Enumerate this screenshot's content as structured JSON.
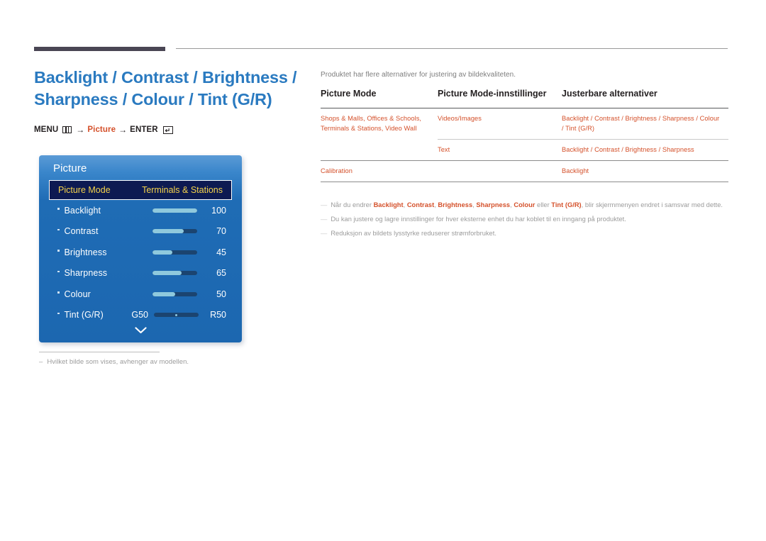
{
  "page": {
    "title": "Backlight / Contrast / Brightness / Sharpness / Colour / Tint (G/R)",
    "breadcrumb": {
      "menu_label": "MENU",
      "menu_icon": "menu-grid-icon",
      "arrow1": "→",
      "picture_label": "Picture",
      "arrow2": "→",
      "enter_label": "ENTER",
      "enter_icon": "enter-key-icon"
    }
  },
  "osd": {
    "title": "Picture",
    "selected_row": {
      "label": "Picture Mode",
      "value": "Terminals & Stations"
    },
    "rows": [
      {
        "label": "Backlight",
        "value": "100",
        "fill_percent": 100
      },
      {
        "label": "Contrast",
        "value": "70",
        "fill_percent": 70
      },
      {
        "label": "Brightness",
        "value": "45",
        "fill_percent": 45
      },
      {
        "label": "Sharpness",
        "value": "65",
        "fill_percent": 65
      },
      {
        "label": "Colour",
        "value": "50",
        "fill_percent": 50
      }
    ],
    "tint_row": {
      "label": "Tint (G/R)",
      "left_value": "G50",
      "right_value": "R50",
      "knob_percent": 50
    },
    "scroll_indicator": "chevron-down-icon",
    "colors": {
      "panel_top": "#5b9bd6",
      "panel_bottom": "#1c67b0",
      "highlight_bg": "#0d1a52",
      "highlight_text": "#f5d34b",
      "slider_fill": "#8fc9dd",
      "slider_track": "#1b4470"
    }
  },
  "left_footnote": {
    "dash": "–",
    "text": "Hvilket bilde som vises, avhenger av modellen."
  },
  "right": {
    "intro": "Produktet har flere alternativer for justering av bildekvaliteten.",
    "table": {
      "headers": [
        "Picture Mode",
        "Picture Mode-innstillinger",
        "Justerbare alternativer"
      ],
      "rows": [
        {
          "mode": "Shops & Malls, Offices & Schools, Terminals & Stations, Video Wall",
          "setting": "Videos/Images",
          "options": "Backlight / Contrast / Brightness / Sharpness / Colour / Tint (G/R)"
        },
        {
          "mode": "",
          "setting": "Text",
          "options": "Backlight / Contrast / Brightness / Sharpness"
        },
        {
          "mode": "Calibration",
          "setting": "",
          "options": "Backlight"
        }
      ]
    },
    "notes": [
      {
        "dash": "—",
        "parts": [
          {
            "t": "Når du endrer ",
            "b": false
          },
          {
            "t": "Backlight",
            "b": true
          },
          {
            "t": ", ",
            "b": false
          },
          {
            "t": "Contrast",
            "b": true
          },
          {
            "t": ", ",
            "b": false
          },
          {
            "t": "Brightness",
            "b": true
          },
          {
            "t": ", ",
            "b": false
          },
          {
            "t": "Sharpness",
            "b": true
          },
          {
            "t": ", ",
            "b": false
          },
          {
            "t": "Colour",
            "b": true
          },
          {
            "t": " eller ",
            "b": false
          },
          {
            "t": "Tint (G/R)",
            "b": true
          },
          {
            "t": ", blir skjermmenyen endret i samsvar med dette.",
            "b": false
          }
        ]
      },
      {
        "dash": "—",
        "parts": [
          {
            "t": "Du kan justere og lagre innstillinger for hver eksterne enhet du har koblet til en inngang på produktet.",
            "b": false
          }
        ]
      },
      {
        "dash": "—",
        "parts": [
          {
            "t": "Reduksjon av bildets lysstyrke reduserer strømforbruket.",
            "b": false
          }
        ]
      }
    ]
  }
}
